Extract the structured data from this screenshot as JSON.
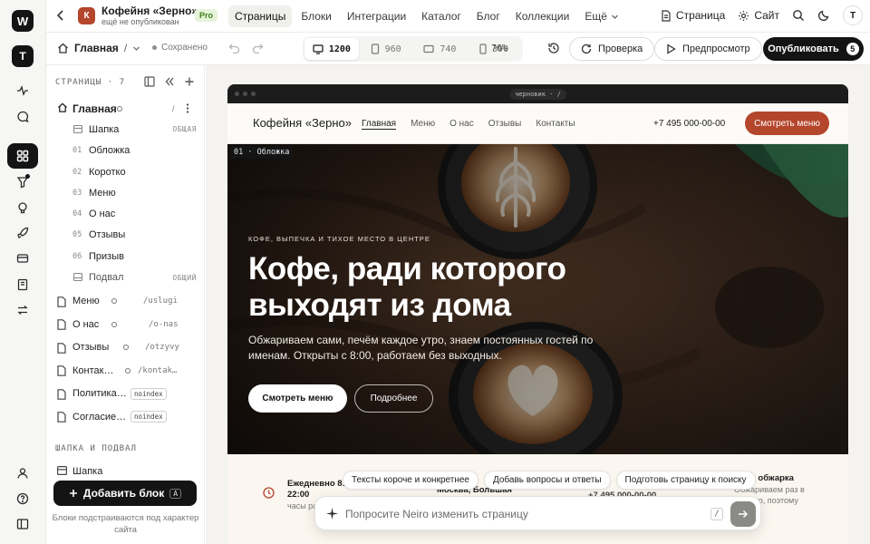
{
  "rail": {
    "logo": "W",
    "workspace": "T",
    "icons": [
      "activity-icon",
      "chat-icon",
      "blocks-icon",
      "filter-icon",
      "brain-icon",
      "rocket-icon",
      "card-icon",
      "book-icon",
      "swap-icon",
      "user-icon",
      "help-icon",
      "layout-icon"
    ]
  },
  "project": {
    "initial": "К",
    "name": "Кофейня «Зерно»",
    "status": "ещё не опубликован",
    "plan": "Pro"
  },
  "nav": {
    "items": [
      "Страницы",
      "Блоки",
      "Интеграции",
      "Каталог",
      "Блог",
      "Коллекции",
      "Ещё"
    ],
    "active": 0
  },
  "topright": {
    "page": "Страница",
    "site": "Сайт",
    "user": "Т"
  },
  "toolbar": {
    "current_page": "Главная",
    "separator": "/",
    "saved": "Сохранено",
    "breakpoints": [
      "1200",
      "960",
      "740",
      "390"
    ],
    "active_breakpoint": 0,
    "zoom": "76%",
    "check": "Проверка",
    "preview": "Предпросмотр",
    "publish": "Опубликовать",
    "publish_count": "5"
  },
  "sidebar": {
    "header": "СТРАНИЦЫ · 7",
    "home": {
      "label": "Главная",
      "slug": "/"
    },
    "blocks": [
      {
        "num": "",
        "label": "Шапка",
        "tag": "ОБЩАЯ"
      },
      {
        "num": "01",
        "label": "Обложка",
        "tag": ""
      },
      {
        "num": "02",
        "label": "Коротко",
        "tag": ""
      },
      {
        "num": "03",
        "label": "Меню",
        "tag": ""
      },
      {
        "num": "04",
        "label": "О нас",
        "tag": ""
      },
      {
        "num": "05",
        "label": "Отзывы",
        "tag": ""
      },
      {
        "num": "06",
        "label": "Призыв",
        "tag": ""
      },
      {
        "num": "",
        "label": "Подвал",
        "tag": "ОБЩИЙ"
      }
    ],
    "pages": [
      {
        "label": "Меню",
        "slug": "/uslugi",
        "badge": ""
      },
      {
        "label": "О нас",
        "slug": "/o-nas",
        "badge": ""
      },
      {
        "label": "Отзывы",
        "slug": "/otzyvy",
        "badge": ""
      },
      {
        "label": "Контак…",
        "slug": "/kontak…",
        "badge": ""
      },
      {
        "label": "Политика…",
        "slug": "",
        "badge": "noindex"
      },
      {
        "label": "Согласие…",
        "slug": "",
        "badge": "noindex"
      }
    ],
    "section2": "ШАПКА И ПОДВАЛ",
    "section2_items": [
      "Шапка"
    ],
    "add_block": "Добавить блок",
    "add_block_key": "A",
    "hint": "Блоки подстраиваются под характер сайта"
  },
  "preview": {
    "status": "черновик · /",
    "site_logo": "Кофейня «Зерно»",
    "site_nav": [
      "Главная",
      "Меню",
      "О нас",
      "Отзывы",
      "Контакты"
    ],
    "site_nav_active": 0,
    "phone": "+7 495 000-00-00",
    "cta": "Смотреть меню",
    "hero_label": "01 · Обложка",
    "kicker": "КОФЕ, ВЫПЕЧКА И ТИХОЕ МЕСТО В ЦЕНТРЕ",
    "title_line1": "Кофе, ради которого",
    "title_line2": "выходят из дома",
    "lead": "Обжариваем сами, печём каждое утро, знаем постоянных гостей по именам. Открыты с 8:00, работаем без выходных.",
    "btn_primary": "Смотреть меню",
    "btn_secondary": "Подробнее",
    "info": [
      {
        "title": "Ежедневно 8:00–22:00",
        "sub": "часы ра…"
      },
      {
        "title": "Москва, Большая",
        "sub": ""
      },
      {
        "title": "+7 495 000-00-00",
        "sub": ""
      },
      {
        "title": "Своя обжарка",
        "sub": "Обжариваем раз в неделю, поэтому"
      }
    ]
  },
  "assistant": {
    "chips": [
      "Тексты короче и конкретнее",
      "Добавь вопросы и ответы",
      "Подготовь страницу к поиску"
    ],
    "placeholder": "Попросите Neiro изменить страницу",
    "slash": "/"
  },
  "colors": {
    "accent": "#b4462c",
    "dark": "#141414",
    "pro_bg": "#e5f4d9",
    "pro_fg": "#3f7d1d",
    "selection": "#8a9a6a"
  }
}
